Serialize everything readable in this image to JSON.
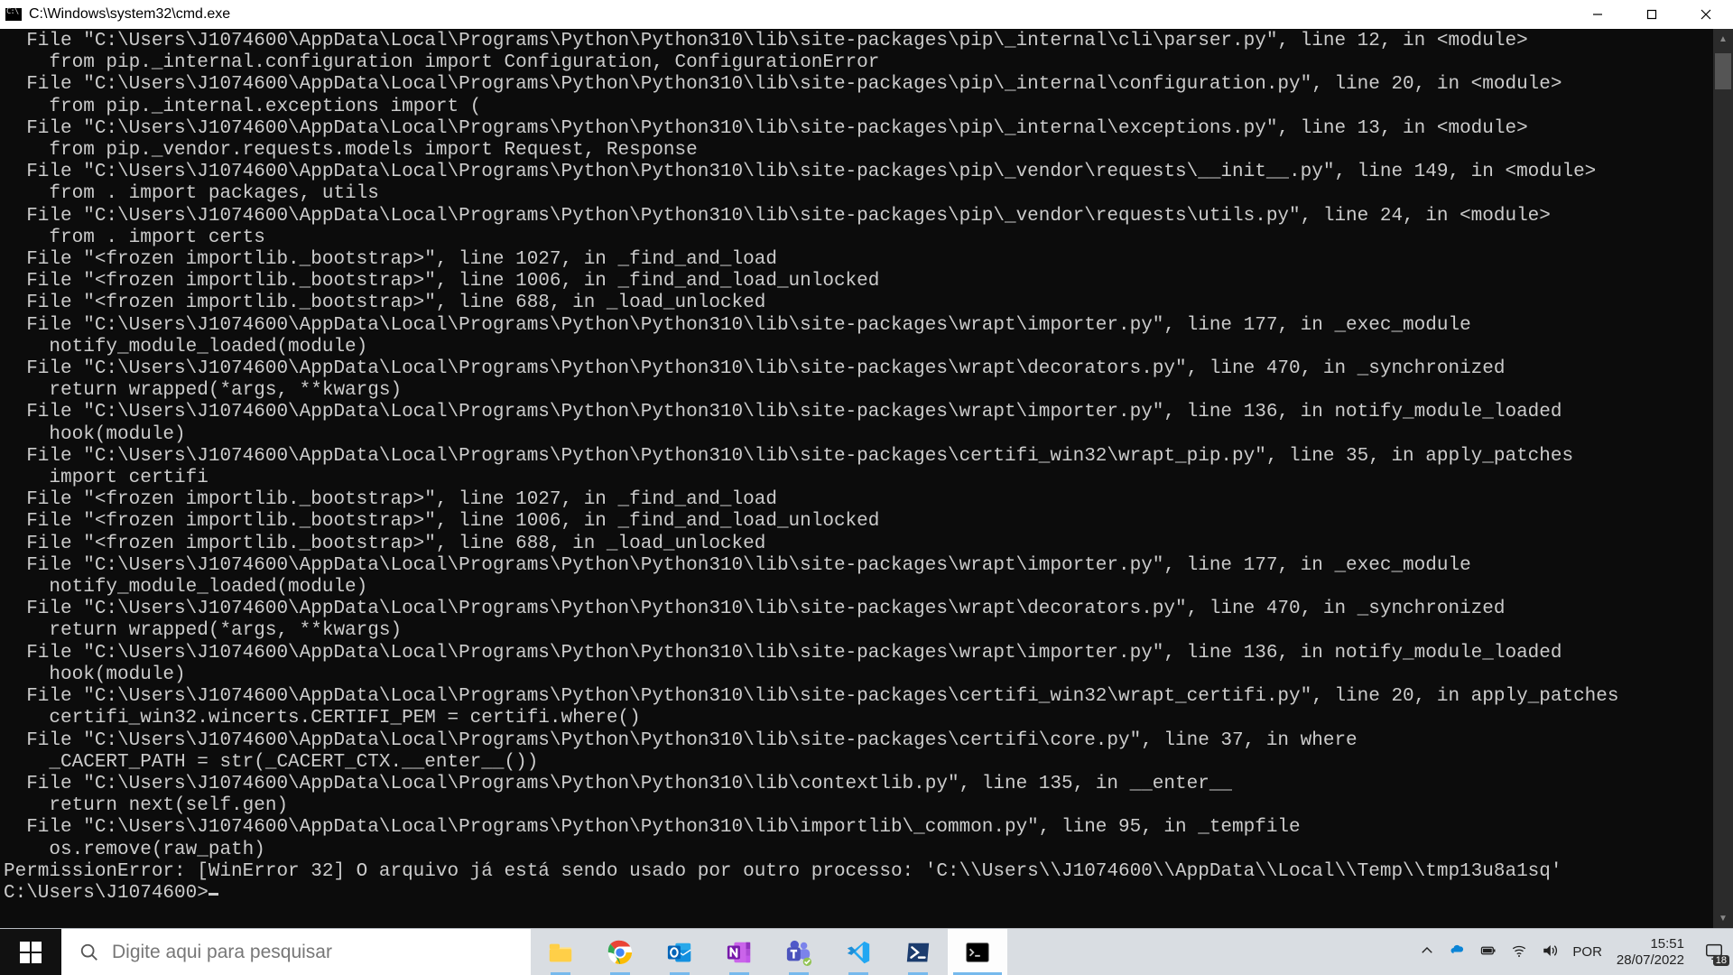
{
  "window": {
    "title": "C:\\Windows\\system32\\cmd.exe"
  },
  "terminal": {
    "lines": [
      "  File \"C:\\Users\\J1074600\\AppData\\Local\\Programs\\Python\\Python310\\lib\\site-packages\\pip\\_internal\\cli\\parser.py\", line 12, in <module>",
      "    from pip._internal.configuration import Configuration, ConfigurationError",
      "  File \"C:\\Users\\J1074600\\AppData\\Local\\Programs\\Python\\Python310\\lib\\site-packages\\pip\\_internal\\configuration.py\", line 20, in <module>",
      "    from pip._internal.exceptions import (",
      "  File \"C:\\Users\\J1074600\\AppData\\Local\\Programs\\Python\\Python310\\lib\\site-packages\\pip\\_internal\\exceptions.py\", line 13, in <module>",
      "    from pip._vendor.requests.models import Request, Response",
      "  File \"C:\\Users\\J1074600\\AppData\\Local\\Programs\\Python\\Python310\\lib\\site-packages\\pip\\_vendor\\requests\\__init__.py\", line 149, in <module>",
      "    from . import packages, utils",
      "  File \"C:\\Users\\J1074600\\AppData\\Local\\Programs\\Python\\Python310\\lib\\site-packages\\pip\\_vendor\\requests\\utils.py\", line 24, in <module>",
      "    from . import certs",
      "  File \"<frozen importlib._bootstrap>\", line 1027, in _find_and_load",
      "  File \"<frozen importlib._bootstrap>\", line 1006, in _find_and_load_unlocked",
      "  File \"<frozen importlib._bootstrap>\", line 688, in _load_unlocked",
      "  File \"C:\\Users\\J1074600\\AppData\\Local\\Programs\\Python\\Python310\\lib\\site-packages\\wrapt\\importer.py\", line 177, in _exec_module",
      "    notify_module_loaded(module)",
      "  File \"C:\\Users\\J1074600\\AppData\\Local\\Programs\\Python\\Python310\\lib\\site-packages\\wrapt\\decorators.py\", line 470, in _synchronized",
      "    return wrapped(*args, **kwargs)",
      "  File \"C:\\Users\\J1074600\\AppData\\Local\\Programs\\Python\\Python310\\lib\\site-packages\\wrapt\\importer.py\", line 136, in notify_module_loaded",
      "    hook(module)",
      "  File \"C:\\Users\\J1074600\\AppData\\Local\\Programs\\Python\\Python310\\lib\\site-packages\\certifi_win32\\wrapt_pip.py\", line 35, in apply_patches",
      "    import certifi",
      "  File \"<frozen importlib._bootstrap>\", line 1027, in _find_and_load",
      "  File \"<frozen importlib._bootstrap>\", line 1006, in _find_and_load_unlocked",
      "  File \"<frozen importlib._bootstrap>\", line 688, in _load_unlocked",
      "  File \"C:\\Users\\J1074600\\AppData\\Local\\Programs\\Python\\Python310\\lib\\site-packages\\wrapt\\importer.py\", line 177, in _exec_module",
      "    notify_module_loaded(module)",
      "  File \"C:\\Users\\J1074600\\AppData\\Local\\Programs\\Python\\Python310\\lib\\site-packages\\wrapt\\decorators.py\", line 470, in _synchronized",
      "    return wrapped(*args, **kwargs)",
      "  File \"C:\\Users\\J1074600\\AppData\\Local\\Programs\\Python\\Python310\\lib\\site-packages\\wrapt\\importer.py\", line 136, in notify_module_loaded",
      "    hook(module)",
      "  File \"C:\\Users\\J1074600\\AppData\\Local\\Programs\\Python\\Python310\\lib\\site-packages\\certifi_win32\\wrapt_certifi.py\", line 20, in apply_patches",
      "    certifi_win32.wincerts.CERTIFI_PEM = certifi.where()",
      "  File \"C:\\Users\\J1074600\\AppData\\Local\\Programs\\Python\\Python310\\lib\\site-packages\\certifi\\core.py\", line 37, in where",
      "    _CACERT_PATH = str(_CACERT_CTX.__enter__())",
      "  File \"C:\\Users\\J1074600\\AppData\\Local\\Programs\\Python\\Python310\\lib\\contextlib.py\", line 135, in __enter__",
      "    return next(self.gen)",
      "  File \"C:\\Users\\J1074600\\AppData\\Local\\Programs\\Python\\Python310\\lib\\importlib\\_common.py\", line 95, in _tempfile",
      "    os.remove(raw_path)",
      "PermissionError: [WinError 32] O arquivo já está sendo usado por outro processo: 'C:\\\\Users\\\\J1074600\\\\AppData\\\\Local\\\\Temp\\\\tmp13u8a1sq'",
      "",
      "C:\\Users\\J1074600>"
    ]
  },
  "taskbar": {
    "search_placeholder": "Digite aqui para pesquisar",
    "language": "POR",
    "time": "15:51",
    "date": "28/07/2022",
    "notification_count": "18",
    "apps": [
      {
        "name": "file-explorer",
        "color1": "#ffcf48",
        "color2": "#ffe28a"
      },
      {
        "name": "chrome"
      },
      {
        "name": "outlook"
      },
      {
        "name": "onenote"
      },
      {
        "name": "teams"
      },
      {
        "name": "vscode"
      },
      {
        "name": "powershell"
      },
      {
        "name": "cmd",
        "active": true
      }
    ]
  }
}
